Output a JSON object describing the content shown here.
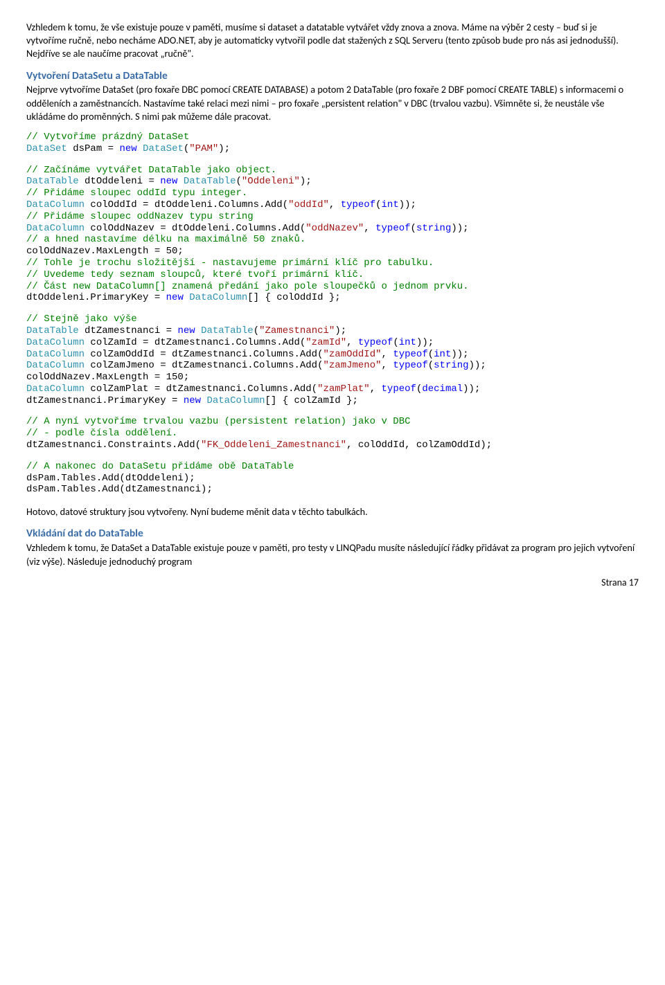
{
  "para1": "Vzhledem k tomu, že vše existuje pouze v paměti, musíme si dataset a datatable vytvářet vždy znova a znova. Máme na výběr 2 cesty – buď si je vytvoříme ručně, nebo necháme ADO.NET, aby je automaticky vytvořil podle dat stažených z SQL Serveru (tento způsob bude pro nás asi jednodušší). Nejdříve se ale naučíme pracovat „ručně\".",
  "heading1": "Vytvoření DataSetu a DataTable",
  "para2": "Nejprve vytvoříme DataSet (pro foxaře DBC pomocí CREATE DATABASE) a potom 2 DataTable (pro foxaře 2 DBF pomocí CREATE TABLE) s informacemi o odděleních a zaměstnancích. Nastavíme také relaci mezi nimi – pro foxaře „persistent relation\" v DBC (trvalou vazbu). Všimněte si, že neustále vše ukládáme do proměnných. S nimi pak můžeme dále pracovat.",
  "c1": {
    "l1": "// Vytvoříme prázdný DataSet",
    "l2a": "DataSet",
    "l2b": " dsPam = ",
    "l2c": "new",
    "l2d": " ",
    "l2e": "DataSet",
    "l2f": "(",
    "l2g": "\"PAM\"",
    "l2h": ");"
  },
  "c2": {
    "l1": "// Začínáme vytvářet DataTable jako object.",
    "l2": [
      "DataTable",
      " dtOddeleni = ",
      "new",
      " ",
      "DataTable",
      "(",
      "\"Oddeleni\"",
      ");"
    ],
    "l3": "// Přidáme sloupec oddId typu integer.",
    "l4": [
      "DataColumn",
      " colOddId = dtOddeleni.Columns.Add(",
      "\"oddId\"",
      ", ",
      "typeof",
      "(",
      "int",
      "));"
    ],
    "l5": "// Přidáme sloupec oddNazev typu string",
    "l6": [
      "DataColumn",
      " colOddNazev = dtOddeleni.Columns.Add(",
      "\"oddNazev\"",
      ", ",
      "typeof",
      "(",
      "string",
      "));"
    ],
    "l7": "// a hned nastavíme délku na maximálně 50 znaků.",
    "l8": "colOddNazev.MaxLength = 50;",
    "l9": "// Tohle je trochu složitější - nastavujeme primární klíč pro tabulku.",
    "l10": "// Uvedeme tedy seznam sloupců, které tvoří primární klíč.",
    "l11": "// Část new DataColumn[] znamená předání jako pole sloupečků o jednom prvku.",
    "l12": [
      "dtOddeleni.PrimaryKey = ",
      "new",
      " ",
      "DataColumn",
      "[] { colOddId };"
    ]
  },
  "c3": {
    "l1": "// Stejně jako výše",
    "l2": [
      "DataTable",
      " dtZamestnanci = ",
      "new",
      " ",
      "DataTable",
      "(",
      "\"Zamestnanci\"",
      ");"
    ],
    "l3": [
      "DataColumn",
      " colZamId = dtZamestnanci.Columns.Add(",
      "\"zamId\"",
      ", ",
      "typeof",
      "(",
      "int",
      "));"
    ],
    "l4": [
      "DataColumn",
      " colZamOddId = dtZamestnanci.Columns.Add(",
      "\"zamOddId\"",
      ", ",
      "typeof",
      "(",
      "int",
      "));"
    ],
    "l5": [
      "DataColumn",
      " colZamJmeno = dtZamestnanci.Columns.Add(",
      "\"zamJmeno\"",
      ", ",
      "typeof",
      "(",
      "string",
      "));"
    ],
    "l6": "colOddNazev.MaxLength = 150;",
    "l7": [
      "DataColumn",
      " colZamPlat = dtZamestnanci.Columns.Add(",
      "\"zamPlat\"",
      ", ",
      "typeof",
      "(",
      "decimal",
      "));"
    ],
    "l8": [
      "dtZamestnanci.PrimaryKey = ",
      "new",
      " ",
      "DataColumn",
      "[] { colZamId };"
    ]
  },
  "c4": {
    "l1": "// A nyní vytvoříme trvalou vazbu (persistent relation) jako v DBC",
    "l2": "// - podle čísla oddělení.",
    "l3": [
      "dtZamestnanci.Constraints.Add(",
      "\"FK_Oddeleni_Zamestnanci\"",
      ", colOddId, colZamOddId);"
    ]
  },
  "c5": {
    "l1": "// A nakonec do DataSetu přidáme obě DataTable",
    "l2": "dsPam.Tables.Add(dtOddeleni);",
    "l3": "dsPam.Tables.Add(dtZamestnanci);"
  },
  "para3": "Hotovo, datové struktury jsou vytvořeny. Nyní budeme měnit data v těchto tabulkách.",
  "heading2": "Vkládání dat do DataTable",
  "para4": "Vzhledem k tomu, že DataSet a DataTable existuje pouze v paměti, pro testy v LINQPadu musíte následující řádky přidávat za program pro jejich vytvoření (viz výše). Následuje jednoduchý program",
  "footer": "Strana 17"
}
